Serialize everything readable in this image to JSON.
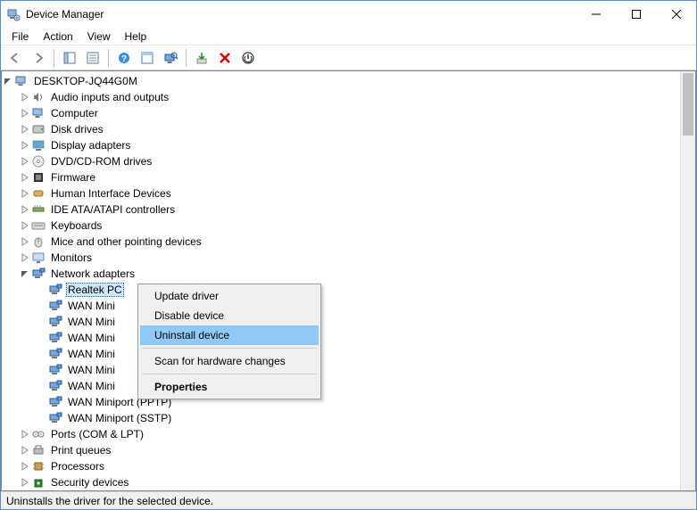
{
  "window": {
    "title": "Device Manager"
  },
  "menu": {
    "file": "File",
    "action": "Action",
    "view": "View",
    "help": "Help"
  },
  "tree": {
    "root": "DESKTOP-JQ44G0M",
    "categories": [
      {
        "label": "Audio inputs and outputs",
        "icon": "speaker"
      },
      {
        "label": "Computer",
        "icon": "computer"
      },
      {
        "label": "Disk drives",
        "icon": "disk"
      },
      {
        "label": "Display adapters",
        "icon": "display"
      },
      {
        "label": "DVD/CD-ROM drives",
        "icon": "cd"
      },
      {
        "label": "Firmware",
        "icon": "firmware"
      },
      {
        "label": "Human Interface Devices",
        "icon": "hid"
      },
      {
        "label": "IDE ATA/ATAPI controllers",
        "icon": "ide"
      },
      {
        "label": "Keyboards",
        "icon": "keyboard"
      },
      {
        "label": "Mice and other pointing devices",
        "icon": "mouse"
      },
      {
        "label": "Monitors",
        "icon": "monitor"
      },
      {
        "label": "Network adapters",
        "icon": "network",
        "expanded": true
      },
      {
        "label": "Ports (COM & LPT)",
        "icon": "port"
      },
      {
        "label": "Print queues",
        "icon": "printer"
      },
      {
        "label": "Processors",
        "icon": "cpu"
      },
      {
        "label": "Security devices",
        "icon": "security"
      }
    ],
    "network_children": [
      {
        "label": "Realtek PC",
        "truncated": true,
        "selected": true
      },
      {
        "label": "WAN Mini",
        "truncated": true
      },
      {
        "label": "WAN Mini",
        "truncated": true
      },
      {
        "label": "WAN Mini",
        "truncated": true
      },
      {
        "label": "WAN Mini",
        "truncated": true
      },
      {
        "label": "WAN Mini",
        "truncated": true
      },
      {
        "label": "WAN Mini",
        "truncated": true
      },
      {
        "label": "WAN Miniport (PPTP)"
      },
      {
        "label": "WAN Miniport (SSTP)"
      }
    ]
  },
  "context_menu": {
    "items": [
      {
        "label": "Update driver"
      },
      {
        "label": "Disable device"
      },
      {
        "label": "Uninstall device",
        "hover": true
      },
      {
        "separator": true
      },
      {
        "label": "Scan for hardware changes"
      },
      {
        "separator": true
      },
      {
        "label": "Properties",
        "bold": true
      }
    ]
  },
  "status": "Uninstalls the driver for the selected device."
}
